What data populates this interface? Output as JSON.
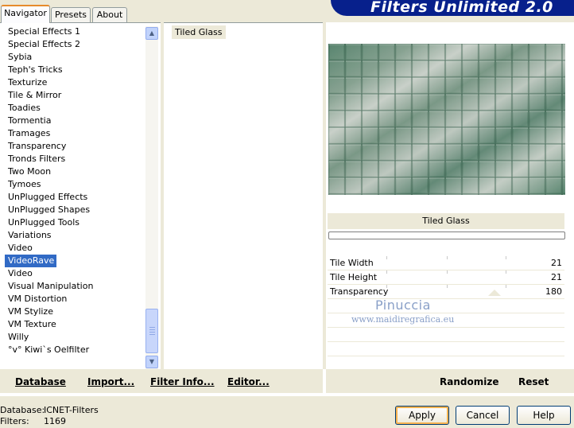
{
  "app": {
    "title": "Filters Unlimited 2.0"
  },
  "tabs": [
    {
      "label": "Navigator",
      "active": true
    },
    {
      "label": "Presets",
      "active": false
    },
    {
      "label": "About",
      "active": false
    }
  ],
  "categories": {
    "items": [
      "Special Effects 1",
      "Special Effects 2",
      "Sybia",
      "Teph's Tricks",
      "Texturize",
      "Tile & Mirror",
      "Toadies",
      "Tormentia",
      "Tramages",
      "Transparency",
      "Tronds Filters",
      "Two Moon",
      "Tymoes",
      "UnPlugged Effects",
      "UnPlugged Shapes",
      "UnPlugged Tools",
      "Variations",
      "Video",
      "VideoRave",
      "Video",
      "Visual Manipulation",
      "VM Distortion",
      "VM Stylize",
      "VM Texture",
      "Willy",
      "°v° Kiwi`s Oelfilter"
    ],
    "selected": "VideoRave"
  },
  "filters": {
    "items": [
      "Tiled Glass"
    ]
  },
  "preview": {
    "filter_name": "Tiled Glass",
    "colors": {
      "tile_dark": "#4a7a62",
      "tile_light": "#c4ccc4"
    }
  },
  "params": [
    {
      "label": "Tile Width",
      "value": "21"
    },
    {
      "label": "Tile Height",
      "value": "21"
    },
    {
      "label": "Transparency",
      "value": "180"
    }
  ],
  "watermark": {
    "name": "Pinuccia",
    "url": "www.maidiregrafica.eu"
  },
  "actions": {
    "database": "Database",
    "import": "Import...",
    "filter_info": "Filter Info...",
    "editor": "Editor...",
    "randomize": "Randomize",
    "reset": "Reset"
  },
  "status": {
    "database_label": "Database:",
    "database_value": "ICNET-Filters",
    "filters_label": "Filters:",
    "filters_value": "1169"
  },
  "buttons": {
    "apply": "Apply",
    "cancel": "Cancel",
    "help": "Help"
  }
}
